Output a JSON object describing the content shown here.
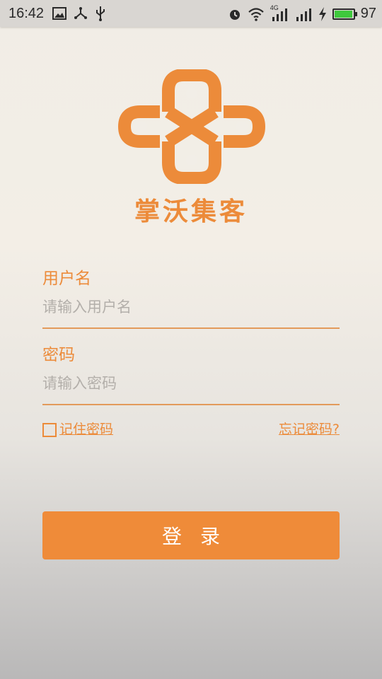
{
  "status_bar": {
    "time": "16:42",
    "network_type": "4G",
    "battery_level": "97",
    "battery_fraction": 0.97,
    "icons": [
      "image-icon",
      "share-network-icon",
      "usb-icon",
      "alarm-icon",
      "wifi-icon",
      "signal-4g-icon",
      "signal-icon",
      "charging-icon",
      "battery-icon"
    ]
  },
  "brand": {
    "name": "掌沃集客",
    "logo_icon": "china-unicom-knot-logo",
    "accent_color": "#ec8b3a"
  },
  "form": {
    "username": {
      "label": "用户名",
      "placeholder": "请输入用户名",
      "value": ""
    },
    "password": {
      "label": "密码",
      "placeholder": "请输入密码",
      "value": ""
    },
    "remember_label": "记住密码",
    "remember_checked": false,
    "forgot_label": "忘记密码?",
    "login_label": "登录"
  }
}
